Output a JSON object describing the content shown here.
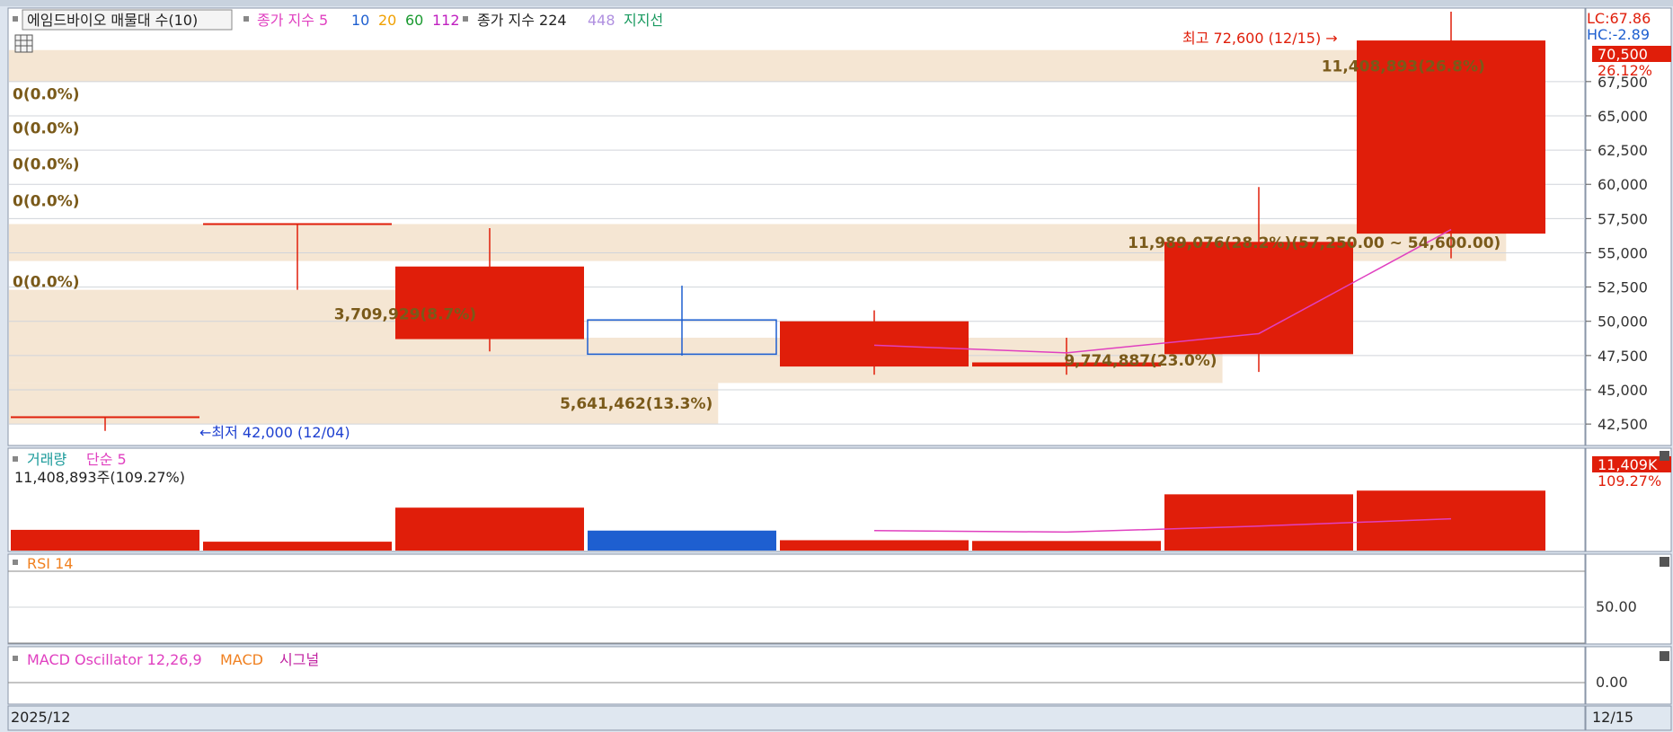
{
  "colors": {
    "up": "#e01e0a",
    "down": "#1e5fd0",
    "ma": "#e040c0",
    "volume_profile": "#f5e6d3",
    "volume_profile_text": "#7a5a1a",
    "panel_bg": "#ffffff",
    "frame_bg": "#dde5ef",
    "grid": "#d0d4da"
  },
  "price_panel": {
    "legend": [
      {
        "text": "에임드바이오 매물대 수(10)",
        "color": "#222222",
        "boxed": true
      },
      {
        "text": "종가 지수 5",
        "color": "#e040c0"
      },
      {
        "text": "10",
        "color": "#1e5fd0"
      },
      {
        "text": "20",
        "color": "#f0a000"
      },
      {
        "text": "60",
        "color": "#1a9a30"
      },
      {
        "text": "112",
        "color": "#c020c0"
      },
      {
        "text": "종가 지수 224",
        "color": "#222222"
      },
      {
        "text": "448",
        "color": "#b090e0"
      },
      {
        "text": "지지선",
        "color": "#1a9a60"
      }
    ],
    "table_icon": "grid-table-icon",
    "lc_label": "LC:67.86",
    "hc_label": "HC:-2.89",
    "current_price_tag": "70,500",
    "current_change_tag": "26.12%",
    "high_annotation": "최고 72,600 (12/15) →",
    "low_annotation": "←최저 42,000 (12/04)",
    "y_ticks": [
      "67,500",
      "65,000",
      "62,500",
      "60,000",
      "57,500",
      "55,000",
      "52,500",
      "50,000",
      "47,500",
      "45,000",
      "42,500"
    ]
  },
  "volume_panel": {
    "legend": [
      {
        "text": "거래량",
        "color": "#1a9a9a"
      },
      {
        "text": "단순 5",
        "color": "#e040c0"
      }
    ],
    "value_text": "11,408,893주(109.27%)",
    "right_tag": "11,409K",
    "right_pct": "109.27%"
  },
  "rsi_panel": {
    "legend": [
      {
        "text": "RSI 14",
        "color": "#f08020"
      }
    ],
    "tick": "50.00"
  },
  "macd_panel": {
    "legend": [
      {
        "text": "MACD Oscillator 12,26,9",
        "color": "#e040c0"
      },
      {
        "text": "MACD",
        "color": "#f08020"
      },
      {
        "text": "시그널",
        "color": "#c020a0"
      }
    ],
    "tick": "0.00"
  },
  "footer": {
    "left": "2025/12",
    "right": "12/15"
  },
  "chart_data": {
    "type": "candlestick",
    "y_range": [
      41000,
      72800
    ],
    "candles": [
      {
        "o": 43000,
        "h": 43000,
        "l": 42000,
        "c": 43000
      },
      {
        "o": 57100,
        "h": 57100,
        "l": 52300,
        "c": 57100
      },
      {
        "o": 48700,
        "h": 56800,
        "l": 47800,
        "c": 54000
      },
      {
        "o": 50100,
        "h": 52600,
        "l": 47500,
        "c": 47600
      },
      {
        "o": 46700,
        "h": 50800,
        "l": 46100,
        "c": 50000
      },
      {
        "o": 46700,
        "h": 48800,
        "l": 46100,
        "c": 47000
      },
      {
        "o": 47600,
        "h": 59800,
        "l": 46300,
        "c": 55800
      },
      {
        "o": 56400,
        "h": 72600,
        "l": 54600,
        "c": 70500
      }
    ],
    "ma_line": [
      {
        "i": 4,
        "v": 48250
      },
      {
        "i": 5,
        "v": 47700
      },
      {
        "i": 6,
        "v": 49100
      },
      {
        "i": 7,
        "v": 56700
      }
    ],
    "volume_profile": [
      {
        "low": 67500,
        "high": 69800,
        "extent": 0.94,
        "label": "11,408,893(26.8%)"
      },
      {
        "low": 54400,
        "high": 57100,
        "extent": 0.95,
        "label": "11,989,076(28.2%)(57,250.00 ~ 54,600.00)"
      },
      {
        "low": 48800,
        "high": 52300,
        "extent": 0.3,
        "label": "3,709,929(8.7%)"
      },
      {
        "low": 45500,
        "high": 48800,
        "extent": 0.77,
        "label": "9,774,887(23.0%)"
      },
      {
        "low": 42500,
        "high": 45500,
        "extent": 0.45,
        "label": "5,641,462(13.3%)"
      }
    ],
    "zero_labels": [
      {
        "price": 66600,
        "label": "0(0.0%)"
      },
      {
        "price": 64100,
        "label": "0(0.0%)"
      },
      {
        "price": 61500,
        "label": "0(0.0%)"
      },
      {
        "price": 58800,
        "label": "0(0.0%)"
      },
      {
        "price": 52900,
        "label": "0(0.0%)"
      }
    ],
    "volume": {
      "max": 11800000,
      "values": [
        2800000,
        1200000,
        5800000,
        2700000,
        1400000,
        1300000,
        7600000,
        8100000
      ],
      "ma5": [
        {
          "i": 4,
          "v": 2700000
        },
        {
          "i": 5,
          "v": 2500000
        },
        {
          "i": 6,
          "v": 3300000
        },
        {
          "i": 7,
          "v": 4300000
        }
      ]
    }
  }
}
